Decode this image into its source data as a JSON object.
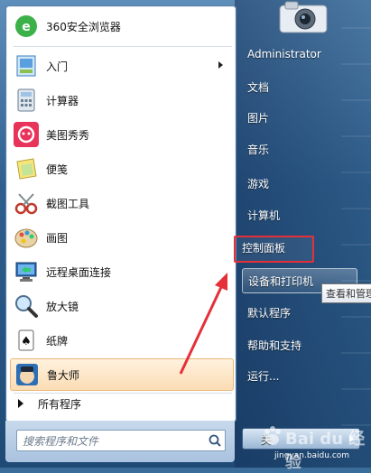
{
  "left_menu": {
    "items": [
      {
        "label": "360安全浏览器",
        "icon": "360-browser-icon"
      },
      {
        "label": "入门",
        "icon": "getting-started-icon"
      },
      {
        "label": "计算器",
        "icon": "calculator-icon"
      },
      {
        "label": "美图秀秀",
        "icon": "meitu-icon"
      },
      {
        "label": "便笺",
        "icon": "sticky-notes-icon"
      },
      {
        "label": "截图工具",
        "icon": "snipping-tool-icon"
      },
      {
        "label": "画图",
        "icon": "paint-icon"
      },
      {
        "label": "远程桌面连接",
        "icon": "remote-desktop-icon"
      },
      {
        "label": "放大镜",
        "icon": "magnifier-icon"
      },
      {
        "label": "纸牌",
        "icon": "solitaire-icon"
      },
      {
        "label": "鲁大师",
        "icon": "ludashi-icon"
      }
    ],
    "all_programs": "所有程序",
    "search_placeholder": "搜索程序和文件"
  },
  "right_menu": {
    "items": [
      {
        "label": "Administrator"
      },
      {
        "label": "文档"
      },
      {
        "label": "图片"
      },
      {
        "label": "音乐"
      },
      {
        "label": "游戏"
      },
      {
        "label": "计算机"
      },
      {
        "label": "控制面板"
      },
      {
        "label": "设备和打印机"
      },
      {
        "label": "默认程序"
      },
      {
        "label": "帮助和支持"
      },
      {
        "label": "运行..."
      }
    ],
    "tooltip": "查看和管理"
  },
  "shutdown": {
    "label": "关"
  },
  "watermark": {
    "text": "Bai du 经验",
    "url": "jingyan.baidu.com"
  },
  "colors": {
    "highlight": "#e5303a",
    "hover": "#fbdcb4"
  }
}
